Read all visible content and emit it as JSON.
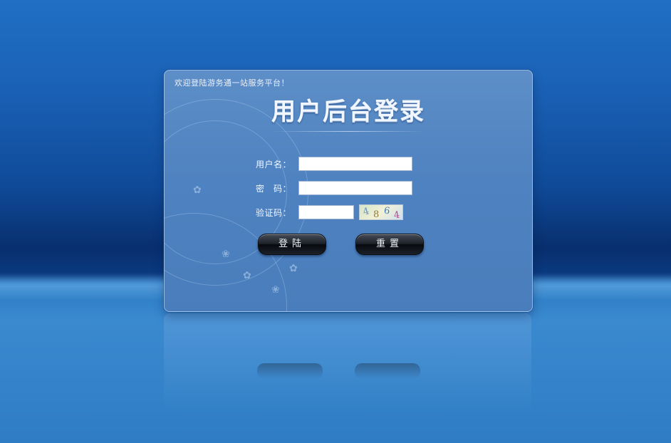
{
  "login": {
    "welcome_text": "欢迎登陆游务通一站服务平台！",
    "title": "用户后台登录",
    "username_label": "用户名：",
    "password_label": "密　码：",
    "captcha_label": "验证码：",
    "username_value": "",
    "password_value": "",
    "captcha_value": "",
    "captcha_chars": [
      "4",
      "8",
      "6",
      "4"
    ],
    "login_button": "登陆",
    "reset_button": "重置"
  },
  "colors": {
    "background": "#1f6fc4",
    "panel": "#5d8ec7",
    "button": "#1c2028"
  }
}
